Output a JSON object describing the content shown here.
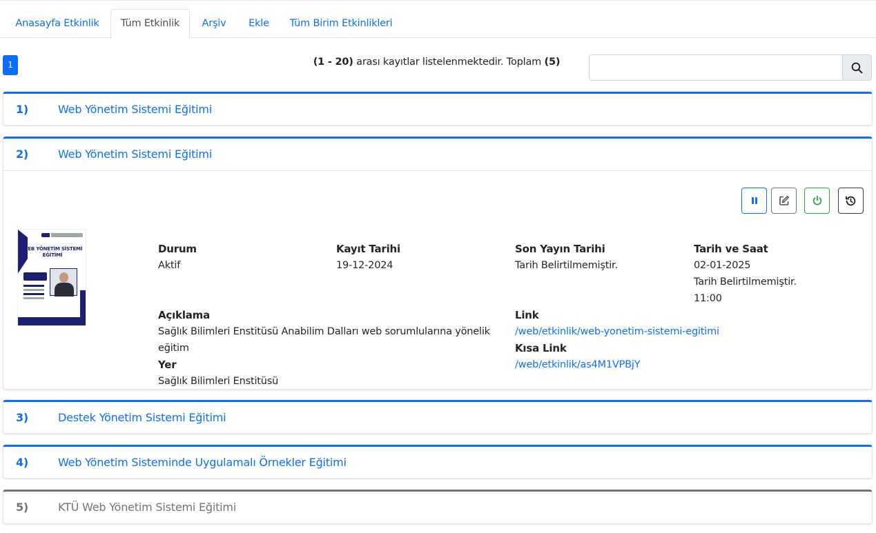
{
  "tabs": [
    {
      "label": "Anasayfa Etkinlik"
    },
    {
      "label": "Tüm Etkinlik"
    },
    {
      "label": "Arşiv"
    },
    {
      "label": "Ekle"
    },
    {
      "label": "Tüm Birim Etkinlikleri"
    }
  ],
  "active_tab": "Tüm Etkinlik",
  "pager": {
    "current_page": "1",
    "range": "(1 - 20)",
    "middle_text": "arası kayıtlar listelenmektedir. Toplam",
    "total": "(5)"
  },
  "search": {
    "value": "",
    "placeholder": ""
  },
  "events": [
    {
      "num": "1)",
      "title": "Web Yönetim Sistemi Eğitimi"
    },
    {
      "num": "2)",
      "title": "Web Yönetim Sistemi Eğitimi"
    },
    {
      "num": "3)",
      "title": "Destek Yönetim Sistemi Eğitimi"
    },
    {
      "num": "4)",
      "title": "Web Yönetim Sisteminde Uygulamalı Örnekler Eğitimi"
    },
    {
      "num": "5)",
      "title": "KTÜ Web Yönetim Sistemi Eğitimi"
    }
  ],
  "detail": {
    "poster_title_line1": "WEB YÖNETİM SİSTEMİ",
    "poster_title_line2": "EĞİTİMİ",
    "durum_label": "Durum",
    "durum_value": "Aktif",
    "kayit_label": "Kayıt Tarihi",
    "kayit_value": "19-12-2024",
    "sonyayin_label": "Son Yayın Tarihi",
    "sonyayin_value": "Tarih Belirtilmemiştir.",
    "tarih_label": "Tarih ve Saat",
    "tarih_value1": "02-01-2025",
    "tarih_value2": "Tarih Belirtilmemiştir.",
    "tarih_value3": "11:00",
    "aciklama_label": "Açıklama",
    "aciklama_line1": "Sağlık Bilimleri Enstitüsü Anabilim Dalları web sorumlularına yönelik",
    "aciklama_line2": "eğitim",
    "yer_label": "Yer",
    "yer_value": "Sağlık Bilimleri Enstitüsü",
    "link_label": "Link",
    "link_value": "/web/etkinlik/web-yonetim-sistemi-egitimi",
    "kisa_label": "Kısa Link",
    "kisa_value": "/web/etkinlik/as4M1VPBjY"
  },
  "colors": {
    "primary": "#0d6efd",
    "success": "#28a745",
    "secondary": "#6c757d"
  },
  "icons": {
    "search": "search-icon",
    "pause": "pause-icon",
    "edit": "edit-icon",
    "power": "power-icon",
    "history": "history-icon"
  }
}
